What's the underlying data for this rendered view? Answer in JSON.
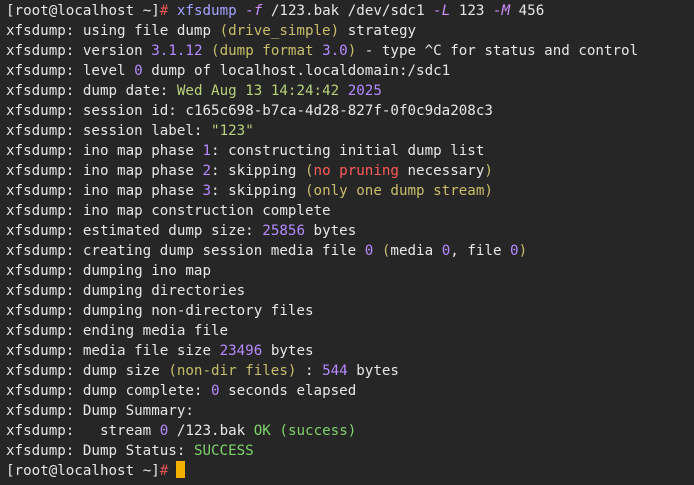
{
  "terminal": {
    "prompt": {
      "open": "[",
      "user_host": "root@localhost",
      "dir": "~",
      "close": "]",
      "hash": "#"
    },
    "command": {
      "name": "xfsdump",
      "opt_f": "-f",
      "target": "/123.bak",
      "device": "/dev/sdc1",
      "opt_L": "-L",
      "session_label": "123",
      "opt_M": "-M",
      "media_label": "456"
    },
    "prefix": "xfsdump:",
    "lines": {
      "l2": "using file dump",
      "l2_paren": "(drive_simple)",
      "l2_end": "strategy",
      "l3": "version",
      "l3_ver": "3.1.12",
      "l3_paren_open": "(dump format",
      "l3_fmt": "3.0",
      "l3_paren_close": ")",
      "l3_end": "- type ^C for status and control",
      "l4_a": "level",
      "l4_num": "0",
      "l4_b": "dump of localhost.localdomain:/sdc1",
      "l5_a": "dump date:",
      "l5_date": "Wed Aug 13 14:24:42",
      "l5_year": "2025",
      "l6_a": "session id:",
      "l6_id": "c165c698-b7ca-4d28-827f-0f0c9da208c3",
      "l7_a": "session label:",
      "l7_label": "\"123\"",
      "l8_a": "ino map phase",
      "l8_num": "1",
      "l8_b": ": constructing initial dump list",
      "l9_a": "ino map phase",
      "l9_num": "2",
      "l9_b": ": skipping",
      "l9_po": "(",
      "l9_red": "no pruning",
      "l9_mid": "necessary",
      "l9_pc": ")",
      "l10_a": "ino map phase",
      "l10_num": "3",
      "l10_b": ": skipping",
      "l10_paren": "(only one dump stream)",
      "l11": "ino map construction complete",
      "l12_a": "estimated dump size:",
      "l12_num": "25856",
      "l12_b": "bytes",
      "l13_a": "creating dump session media file",
      "l13_n1": "0",
      "l13_po": "(",
      "l13_b": "media",
      "l13_n2": "0",
      "l13_c": ", file",
      "l13_n3": "0",
      "l13_pc": ")",
      "l14": "dumping ino map",
      "l15": "dumping directories",
      "l16": "dumping non-directory files",
      "l17": "ending media file",
      "l18_a": "media file size",
      "l18_num": "23496",
      "l18_b": "bytes",
      "l19_a": "dump size",
      "l19_paren": "(non-dir files)",
      "l19_b": ":",
      "l19_num": "544",
      "l19_c": "bytes",
      "l20_a": "dump complete:",
      "l20_num": "0",
      "l20_b": "seconds elapsed",
      "l21": "Dump Summary:",
      "l22_a": "  stream",
      "l22_num": "0",
      "l22_b": "/123.bak",
      "l22_ok": "OK",
      "l22_paren": "(success)",
      "l23_a": "Dump Status:",
      "l23_status": "SUCCESS"
    }
  }
}
